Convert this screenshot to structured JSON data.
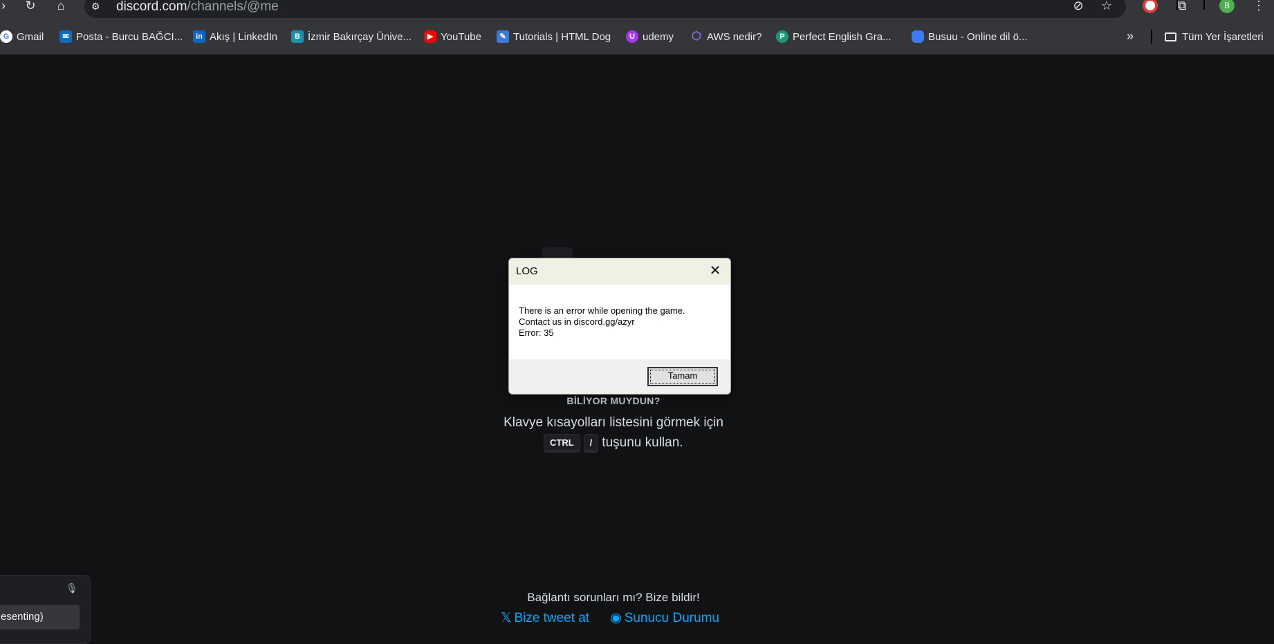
{
  "browser": {
    "url_domain": "discord.com",
    "url_path": "/channels/@me",
    "profile_initial": "B",
    "icons": [
      "back-icon",
      "reload-icon",
      "home-icon",
      "site-info-icon",
      "eye-off-icon",
      "star-icon",
      "record-icon",
      "extensions-icon",
      "menu-icon"
    ]
  },
  "bookmarks": [
    {
      "label": "Gmail",
      "icon": "google-icon",
      "color": "#4285f4"
    },
    {
      "label": "Posta - Burcu BAĞCI...",
      "icon": "outlook-icon",
      "color": "#0f6cbd"
    },
    {
      "label": "Akış | LinkedIn",
      "icon": "linkedin-icon",
      "color": "#0a66c2"
    },
    {
      "label": "İzmir Bakırçay Ünive...",
      "icon": "university-icon",
      "color": "#1b8fa8"
    },
    {
      "label": "YouTube",
      "icon": "youtube-icon",
      "color": "#ff0000"
    },
    {
      "label": "Tutorials | HTML Dog",
      "icon": "htmldog-icon",
      "color": "#3d7ad6"
    },
    {
      "label": "udemy",
      "icon": "udemy-icon",
      "color": "#a435f0"
    },
    {
      "label": "AWS nedir?",
      "icon": "aws-cube-icon",
      "color": "#8c6cf0"
    },
    {
      "label": "Perfect English Gra...",
      "icon": "pe-icon",
      "color": "#1a9a7a"
    },
    {
      "label": "Busuu - Online dil ö...",
      "icon": "busuu-icon",
      "color": "#3b7cf6"
    }
  ],
  "bookmarks_folder": "Tüm Yer İşaretleri",
  "dialog": {
    "title": "LOG",
    "line1": "There is an error while opening the game.",
    "line2": "Contact us in discord.gg/azyr",
    "line3": "Error: 35",
    "ok_label": "Tamam"
  },
  "tip": {
    "heading": "BİLİYOR MUYDUN?",
    "line1": "Klavye kısayolları listesini görmek için",
    "key1": "CTRL",
    "key2": "/",
    "line2_suffix": "tuşunu kullan."
  },
  "footer": {
    "question": "Bağlantı sorunları mı? Bize bildir!",
    "tweet_label": "Bize tweet at",
    "status_label": "Sunucu Durumu"
  },
  "panel": {
    "item_label": "esenting)"
  }
}
